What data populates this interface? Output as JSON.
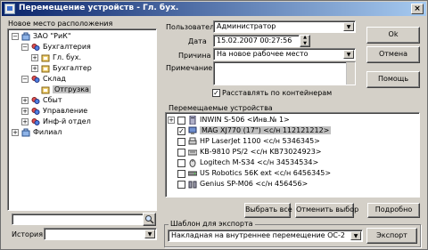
{
  "window": {
    "title": "Перемещение устройств - Гл. бух.",
    "close": "×"
  },
  "left_panel": {
    "heading": "Новое место расположения",
    "tree": [
      {
        "label": "ЗАО \"РиК\"",
        "level": 0,
        "expander": "−",
        "icon": "company-icon"
      },
      {
        "label": "Бухгалтерия",
        "level": 1,
        "expander": "−",
        "icon": "department-icon"
      },
      {
        "label": "Гл. бух.",
        "level": 2,
        "expander": "+",
        "icon": "room-icon"
      },
      {
        "label": "Бухгалтер",
        "level": 2,
        "expander": "+",
        "icon": "room-icon"
      },
      {
        "label": "Склад",
        "level": 1,
        "expander": "−",
        "icon": "department-icon"
      },
      {
        "label": "Отгрузка",
        "level": 2,
        "expander": "",
        "icon": "room-icon",
        "selected": true
      },
      {
        "label": "Сбыт",
        "level": 1,
        "expander": "+",
        "icon": "department-icon"
      },
      {
        "label": "Управление",
        "level": 1,
        "expander": "+",
        "icon": "department-icon"
      },
      {
        "label": "Инф-й отдел",
        "level": 1,
        "expander": "+",
        "icon": "department-icon"
      },
      {
        "label": "Филиал",
        "level": 0,
        "expander": "+",
        "icon": "company-icon"
      }
    ],
    "search_value": "",
    "history_label": "История",
    "history_value": ""
  },
  "form": {
    "user_label": "Пользователь",
    "user_value": "Администратор",
    "date_label": "Дата",
    "date_value": "15.02.2007 00:27:56",
    "reason_label": "Причина",
    "reason_value": "На новое рабочее место",
    "note_label": "Примечание",
    "note_value": "",
    "container_checkbox_label": "Расставлять по контейнерам",
    "container_checked": true
  },
  "buttons": {
    "ok": "Ok",
    "cancel": "Отмена",
    "help": "Помощь",
    "select_all": "Выбрать все",
    "deselect": "Отменить выбор",
    "details": "Подробно",
    "export": "Экспорт"
  },
  "devices": {
    "heading": "Перемещаемые устройства",
    "items": [
      {
        "label": "INWIN S-506 <Инв.№ 1>",
        "checked": false,
        "expander": "+",
        "icon": "computer-icon"
      },
      {
        "label": "MAG XJ770 (17\") <с/н 112121212>",
        "checked": true,
        "expander": "",
        "icon": "monitor-icon",
        "selected": true
      },
      {
        "label": "HP LaserJet 1100 <с/н 5346345>",
        "checked": false,
        "expander": "",
        "icon": "printer-icon"
      },
      {
        "label": "KB-9810 PS/2 <с/н KB73024923>",
        "checked": false,
        "expander": "",
        "icon": "keyboard-icon"
      },
      {
        "label": "Logitech M-S34 <с/н 34534534>",
        "checked": false,
        "expander": "",
        "icon": "mouse-icon"
      },
      {
        "label": "US Robotics 56K ext <с/н 6456345>",
        "checked": false,
        "expander": "",
        "icon": "modem-icon"
      },
      {
        "label": "Genius SP-M06 <с/н 456456>",
        "checked": false,
        "expander": "",
        "icon": "speakers-icon"
      }
    ]
  },
  "export": {
    "group_label": "Шаблон для экспорта",
    "template_value": "Накладная на внутреннее перемещение ОС-2"
  }
}
